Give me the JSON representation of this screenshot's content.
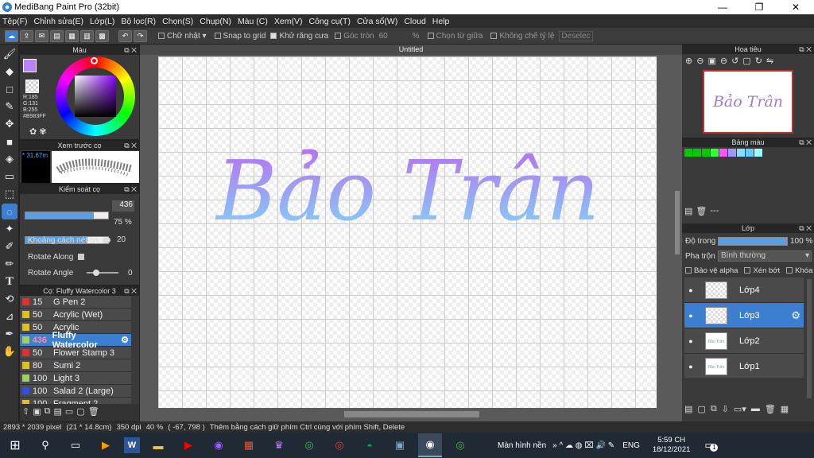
{
  "window": {
    "title": "MediBang Paint Pro (32bit)"
  },
  "menu": [
    "Tệp(F)",
    "Chỉnh sửa(E)",
    "Lớp(L)",
    "Bộ lọc(R)",
    "Chọn(S)",
    "Chụp(N)",
    "Màu (C)",
    "Xem(V)",
    "Công cụ(T)",
    "Cửa sổ(W)",
    "Cloud",
    "Help"
  ],
  "toolbar": {
    "update": "Chữ nhật",
    "snap": "Snap to grid",
    "antialias": "Khử răng cưa",
    "corner": "Góc tròn",
    "corner_val": "60",
    "percent": "%",
    "center": "Chọn từ giữa",
    "nolimit": "Không chế tỷ lệ",
    "deselect": "Deselec"
  },
  "color_panel": {
    "title": "Màu",
    "r": "R:185",
    "g": "G:131",
    "b": "B:255",
    "hex": "#B983FF",
    "fg": "#B983FF"
  },
  "brush_preview": {
    "title": "Xem trước cọ",
    "size": "* 31.67m"
  },
  "brush_control": {
    "title": "Kiểm soát cọ",
    "size": "436",
    "opacity": "75 %",
    "size_fraction": 0.83,
    "opacity_fraction": 0.75,
    "spacing_label": "Khoảng cách nét cọ",
    "spacing_val": "20",
    "rotate_along": "Rotate Along",
    "rotate_angle": "Rotate Angle",
    "rotate_val": "0"
  },
  "brush_list": {
    "title": "Cọ: Fluffy Watercolor 3",
    "items": [
      {
        "size": "15",
        "name": "G Pen 2",
        "color": "#e03030"
      },
      {
        "size": "50",
        "name": "Acrylic (Wet)",
        "color": "#e0c020"
      },
      {
        "size": "50",
        "name": "Acrylic",
        "color": "#e0c020"
      },
      {
        "size": "436",
        "name": "Fluffy Watercolor",
        "color": "#a0d060",
        "selected": true
      },
      {
        "size": "50",
        "name": "Flower Stamp 3",
        "color": "#e03030"
      },
      {
        "size": "80",
        "name": "Sumi 2",
        "color": "#e0c020"
      },
      {
        "size": "100",
        "name": "Light 3",
        "color": "#a0d060"
      },
      {
        "size": "100",
        "name": "Salad 2 (Large)",
        "color": "#3050e0"
      },
      {
        "size": "100",
        "name": "Fragment 2",
        "color": "#e0c020"
      }
    ]
  },
  "canvas": {
    "tab": "Untitled",
    "text": "Bảo Trân"
  },
  "navigator": {
    "title": "Hoa tiêu",
    "thumb_text": "Bảo Trân"
  },
  "palette": {
    "title": "Bảng màu",
    "colors": [
      "#00cc00",
      "#00cc00",
      "#00cc00",
      "#33ff33",
      "#ff55ff",
      "#9999ff",
      "#88ddff",
      "#66ccff",
      "#99ffff"
    ],
    "dash": "---"
  },
  "layers": {
    "title": "Lớp",
    "opacity_label": "Độ trong",
    "opacity": "100 %",
    "blend_label": "Pha trộn",
    "blend": "Bình thường",
    "protect": "Bảo vệ alpha",
    "clip": "Xén bớt",
    "lock": "Khóa",
    "items": [
      {
        "name": "Lớp4"
      },
      {
        "name": "Lớp3",
        "selected": true
      },
      {
        "name": "Lớp2",
        "thumb": "Bảo Trân"
      },
      {
        "name": "Lớp1",
        "thumb": "Bảo Trân"
      }
    ]
  },
  "status": {
    "size": "2893 * 2039 pixel",
    "cm": "(21 * 14.8cm)",
    "dpi": "350 dpi",
    "zoom": "40 %",
    "coord": "( -67, 798 )",
    "hint": "Thêm bằng cách giữ phím Ctrl cùng với phím Shift, Delete"
  },
  "taskbar": {
    "desktop": "Màn hình nền",
    "lang": "ENG",
    "time": "5:59 CH",
    "date": "18/12/2021",
    "notif": "1"
  }
}
